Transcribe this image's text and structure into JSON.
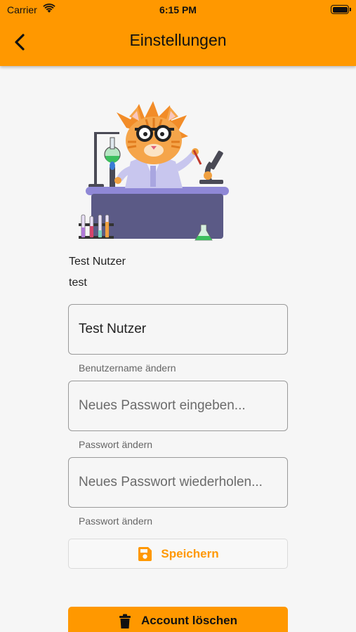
{
  "status_bar": {
    "carrier": "Carrier",
    "time": "6:15 PM"
  },
  "header": {
    "title": "Einstellungen",
    "back_icon": "chevron-left-icon"
  },
  "profile": {
    "display_name": "Test Nutzer",
    "username": "test",
    "illustration": "cat-scientist-illustration"
  },
  "form": {
    "username_field": {
      "value": "Test Nutzer",
      "placeholder": "",
      "helper": "Benutzername ändern"
    },
    "password_field": {
      "value": "",
      "placeholder": "Neues Passwort eingeben...",
      "helper": "Passwort ändern"
    },
    "password_repeat_field": {
      "value": "",
      "placeholder": "Neues Passwort wiederholen...",
      "helper": "Passwort ändern"
    }
  },
  "actions": {
    "save_label": "Speichern",
    "save_icon": "floppy-disk-icon",
    "delete_label": "Account löschen",
    "delete_icon": "trash-icon"
  },
  "colors": {
    "accent": "#ff9800",
    "background": "#f6f6f6"
  }
}
